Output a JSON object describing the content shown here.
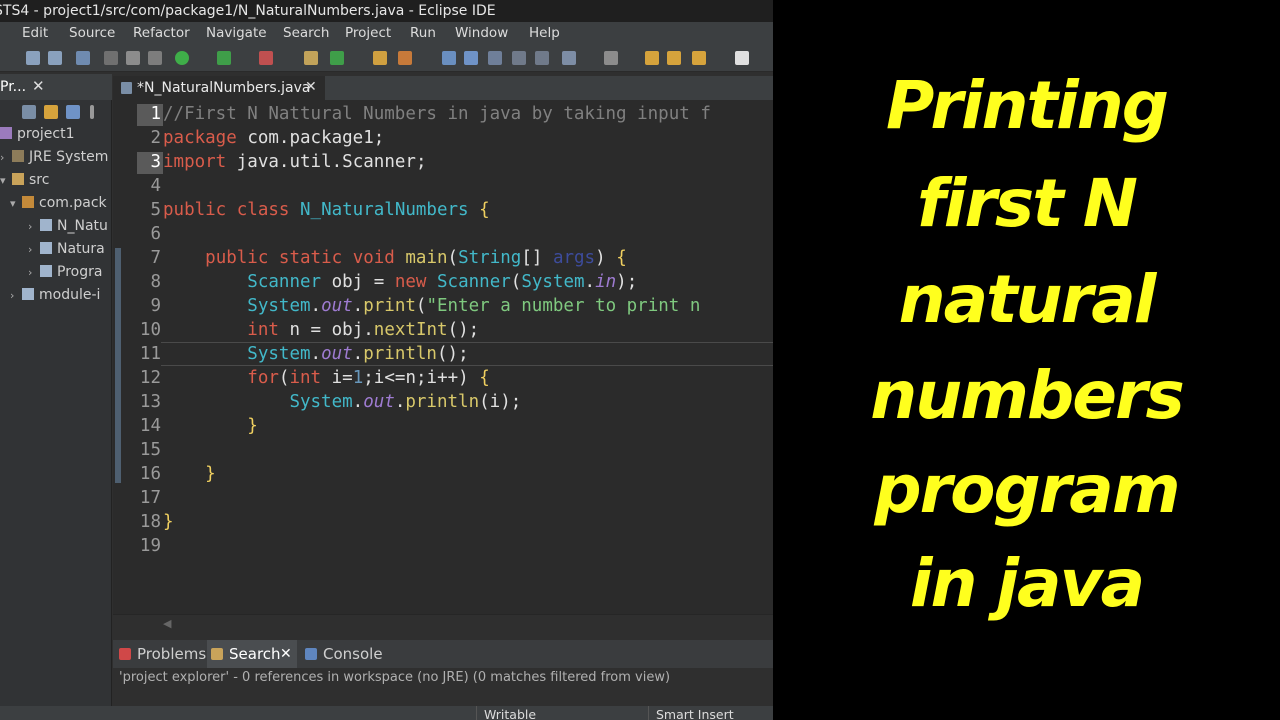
{
  "window": {
    "title": "STS4 - project1/src/com/package1/N_NaturalNumbers.java - Eclipse IDE"
  },
  "menu": [
    "Edit",
    "Source",
    "Refactor",
    "Navigate",
    "Search",
    "Project",
    "Run",
    "Window",
    "Help"
  ],
  "explorer": {
    "tab_label": "Pr...",
    "close": "✕",
    "items": [
      {
        "label": "project1",
        "arrow": "▾",
        "icon": "project-icon"
      },
      {
        "label": "JRE System",
        "arrow": "›",
        "icon": "library-icon"
      },
      {
        "label": "src",
        "arrow": "▾",
        "icon": "source-folder-icon"
      },
      {
        "label": "com.pack",
        "arrow": "▾",
        "icon": "package-icon"
      },
      {
        "label": "N_Natu",
        "arrow": "›",
        "icon": "java-file-icon"
      },
      {
        "label": "Natura",
        "arrow": "›",
        "icon": "java-file-icon"
      },
      {
        "label": "Progra",
        "arrow": "›",
        "icon": "java-file-icon"
      },
      {
        "label": "module-i",
        "arrow": "›",
        "icon": "java-file-icon"
      }
    ]
  },
  "editor": {
    "tab_label": "*N_NaturalNumbers.java",
    "close": "✕",
    "line_numbers": [
      "1",
      "2",
      "3",
      "4",
      "5",
      "6",
      "7",
      "8",
      "9",
      "10",
      "11",
      "12",
      "13",
      "14",
      "15",
      "16",
      "17",
      "18",
      "19"
    ],
    "lines": [
      "//First N Nattural Numbers in java by taking input f",
      "package com.package1;",
      "import java.util.Scanner;",
      "",
      "public class N_NaturalNumbers {",
      "",
      "    public static void main(String[] args) {",
      "        Scanner obj = new Scanner(System.in);",
      "        System.out.print(\"Enter a number to print n",
      "        int n = obj.nextInt();",
      "        System.out.println();",
      "        for(int i=1;i<=n;i++) {",
      "            System.out.println(i);",
      "        }",
      "",
      "    }",
      "",
      "}",
      ""
    ]
  },
  "bottom_panel": {
    "tabs": [
      "Problems",
      "Search",
      "Console"
    ],
    "active_tab": "Search",
    "close": "✕",
    "status_text": "'project explorer' - 0 references in workspace (no JRE) (0 matches filtered from view)"
  },
  "statusbar": {
    "writable": "Writable",
    "insert_mode": "Smart Insert"
  },
  "title_overlay": {
    "lines": [
      "Printing",
      "first N",
      "natural",
      "numbers",
      "program",
      "in java"
    ],
    "color": "#ffff1e"
  }
}
